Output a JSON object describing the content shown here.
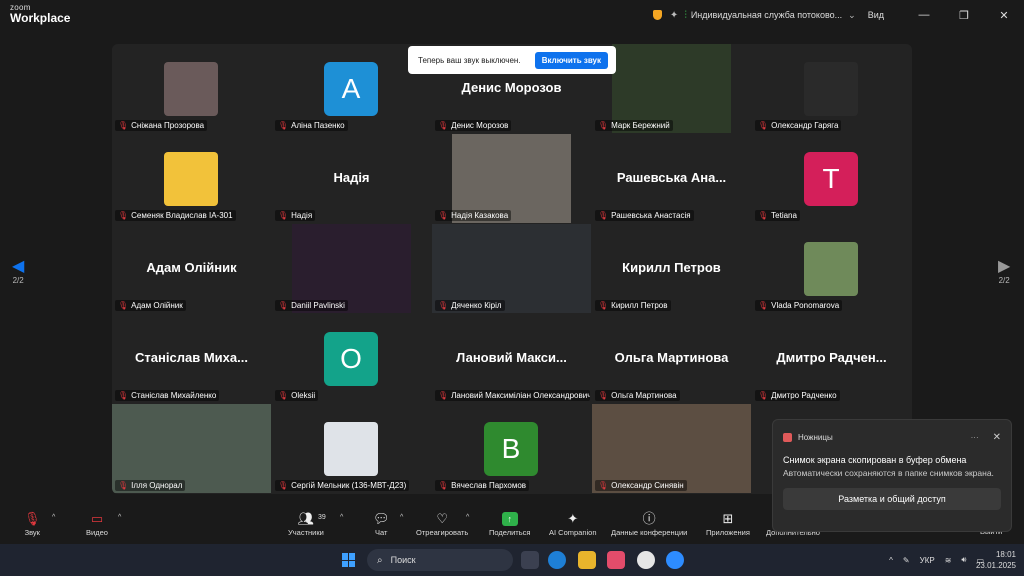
{
  "app": {
    "logo_line1": "zoom",
    "logo_line2": "Workplace",
    "meeting_title": "Индивидуальная служба потоково...",
    "view_label": "Вид"
  },
  "notice": {
    "text": "Теперь ваш звук выключен.",
    "button": "Включить звук"
  },
  "pager": {
    "left": "2/2",
    "right": "2/2"
  },
  "tiles": [
    {
      "name": "Сніжана Прозорова",
      "kind": "photo",
      "color": "#6a5a5a"
    },
    {
      "name": "Аліна Пазенко",
      "kind": "letter",
      "letter": "A",
      "color": "#1e90d6"
    },
    {
      "name": "Денис Морозов",
      "kind": "name",
      "display": "Денис Морозов"
    },
    {
      "name": "Марк Бережний",
      "kind": "video",
      "color": "#2d3a28"
    },
    {
      "name": "Олександр Гаряга",
      "kind": "photo",
      "color": "#2a2a2a"
    },
    {
      "name": "Семеняк Владислав ІА-301",
      "kind": "photo",
      "color": "#f2c23a"
    },
    {
      "name": "Надія",
      "kind": "name",
      "display": "Надія"
    },
    {
      "name": "Надія Казакова",
      "kind": "video",
      "color": "#6b6660"
    },
    {
      "name": "Рашевська Анастасія",
      "kind": "name",
      "display": "Рашевська Ана..."
    },
    {
      "name": "Tetiana",
      "kind": "letter",
      "letter": "T",
      "color": "#d41f5a"
    },
    {
      "name": "Адам Олійник",
      "kind": "name",
      "display": "Адам Олійник"
    },
    {
      "name": "Daniil Pavlinski",
      "kind": "video",
      "color": "#2a1e2e"
    },
    {
      "name": "Дяченко Кіріл",
      "kind": "videofull",
      "color": "#2c2f33"
    },
    {
      "name": "Кирилл Петров",
      "kind": "name",
      "display": "Кирилл Петров"
    },
    {
      "name": "Vlada Ponomarova",
      "kind": "photo",
      "color": "#6f8a5a"
    },
    {
      "name": "Станіслав Михайленко",
      "kind": "name",
      "display": "Станіслав Миха..."
    },
    {
      "name": "Oleksii",
      "kind": "letter",
      "letter": "O",
      "color": "#13a38a"
    },
    {
      "name": "Лановий Максиміліан Олександрович",
      "kind": "name",
      "display": "Лановий Макси..."
    },
    {
      "name": "Ольга Мартинова",
      "kind": "name",
      "display": "Ольга Мартинова"
    },
    {
      "name": "Дмитро Радченко",
      "kind": "name",
      "display": "Дмитро Радчен..."
    },
    {
      "name": "Ілля Однорал",
      "kind": "videofull",
      "color": "#4d5a50"
    },
    {
      "name": "Сергій Мельник (136-МВТ-Д23)",
      "kind": "photo",
      "color": "#dfe3e8"
    },
    {
      "name": "Вячеслав Пархомов",
      "kind": "letter",
      "letter": "B",
      "color": "#2f8a2f"
    },
    {
      "name": "Олександр Синявін",
      "kind": "videofull",
      "color": "#5c4e42"
    }
  ],
  "toast": {
    "app_name": "Ножницы",
    "title": "Снимок экрана скопирован в буфер обмена",
    "body": "Автоматически сохраняются в папке снимков экрана.",
    "button": "Разметка и общий доступ"
  },
  "toolbar": {
    "audio": "Звук",
    "video": "Видео",
    "participants": "Участники",
    "participants_count": "39",
    "chat": "Чат",
    "react": "Отреагировать",
    "share": "Поделиться",
    "ai": "AI Companion",
    "info": "Данные конференции",
    "apps": "Приложения",
    "more": "Дополнительно",
    "leave": "Выйти"
  },
  "taskbar": {
    "search": "Поиск",
    "lang": "УКР",
    "time": "18:01",
    "date": "23.01.2025"
  }
}
